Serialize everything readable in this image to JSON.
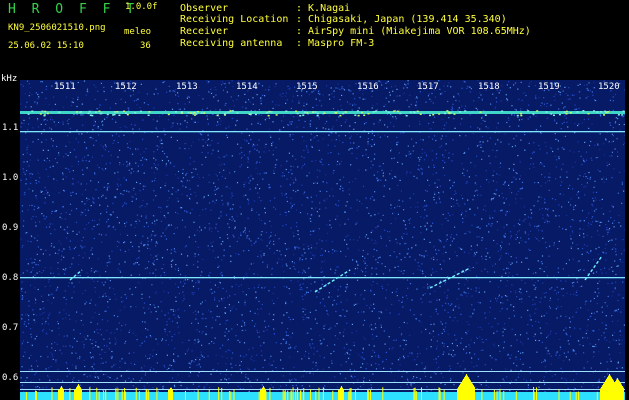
{
  "header": {
    "app_name": "H R O F F T",
    "version": "1.0.0f",
    "filename": "KN9_2506021510.png",
    "datetime": "25.06.02 15:10",
    "mode": "meleo",
    "count": "36"
  },
  "info": {
    "rows": [
      {
        "label": "Observer",
        "value": ": K.Nagai"
      },
      {
        "label": "Receiving Location",
        "value": ": Chigasaki, Japan (139.414 35.340)"
      },
      {
        "label": "Receiver",
        "value": ": AirSpy mini (Miakejima VOR 108.65MHz)"
      },
      {
        "label": "Receiving antenna",
        "value": ": Maspro FM-3"
      }
    ]
  },
  "axis": {
    "unit": "kHz",
    "y_labels": [
      "1.1",
      "1.0",
      "0.9",
      "0.8",
      "0.7",
      "0.6"
    ],
    "x_labels": [
      "1511",
      "1512",
      "1513",
      "1514",
      "1515",
      "1516",
      "1517",
      "1518",
      "1519",
      "1520"
    ]
  },
  "colors": {
    "background": "#000000",
    "plot_bg": "#071a66",
    "header_green": "#35d24a",
    "header_yellow": "#ffff3c",
    "signal_cyan": "#2ee0ff",
    "signal_yellow": "#ffff00"
  }
}
